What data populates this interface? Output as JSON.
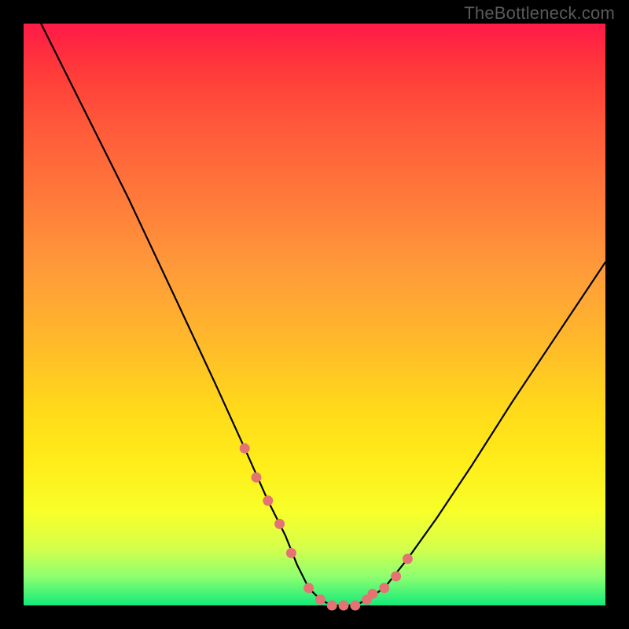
{
  "watermark": "TheBottleneck.com",
  "colors": {
    "page_bg": "#000000",
    "gradient_top": "#ff1a47",
    "gradient_bottom": "#12eb7a",
    "curve": "#000000",
    "marker": "#e57373"
  },
  "chart_data": {
    "type": "line",
    "title": "",
    "xlabel": "",
    "ylabel": "",
    "x_range": [
      0,
      100
    ],
    "y_range": [
      0,
      100
    ],
    "grid": false,
    "legend": false,
    "series": [
      {
        "name": "curve",
        "x": [
          3,
          10,
          18,
          26,
          33,
          38,
          42,
          45,
          47,
          49,
          51,
          53,
          55,
          57,
          59,
          62,
          66,
          71,
          77,
          84,
          92,
          100
        ],
        "y": [
          100,
          86,
          70,
          53,
          38,
          27,
          18,
          12,
          7,
          3,
          1,
          0,
          0,
          0,
          1,
          3,
          8,
          15,
          24,
          35,
          47,
          59
        ]
      }
    ],
    "markers": {
      "name": "highlight-points",
      "x": [
        38,
        40,
        42,
        44,
        46,
        49,
        51,
        53,
        55,
        57,
        59,
        60,
        62,
        64,
        66
      ],
      "y": [
        27,
        22,
        18,
        14,
        9,
        3,
        1,
        0,
        0,
        0,
        1,
        2,
        3,
        5,
        8
      ]
    }
  }
}
